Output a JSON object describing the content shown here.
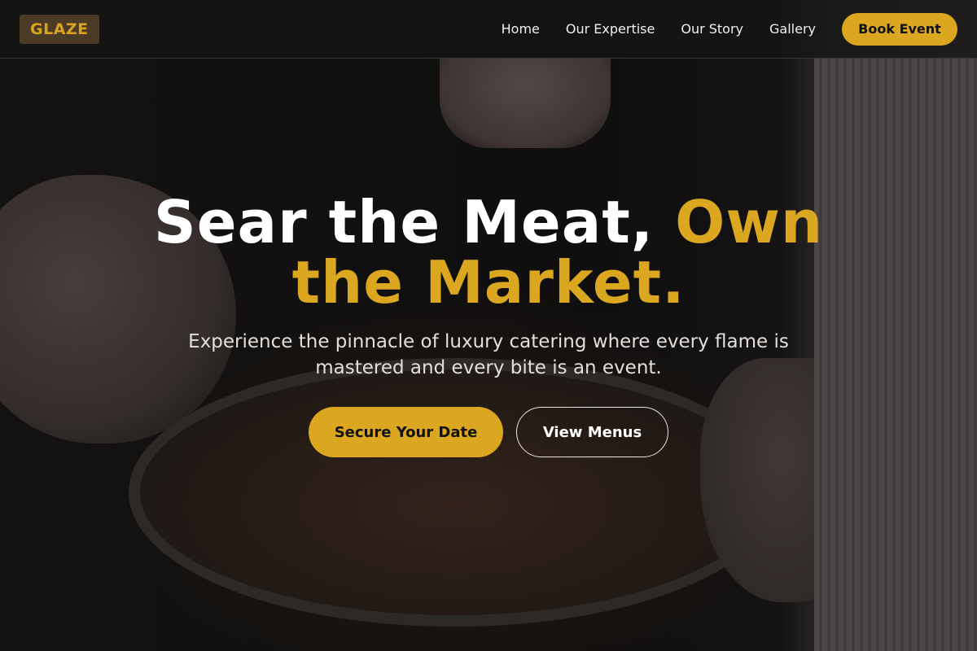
{
  "brand": {
    "logo_text": "GLAZE",
    "accent_color": "#dba721"
  },
  "nav": {
    "links": [
      {
        "label": "Home"
      },
      {
        "label": "Our Expertise"
      },
      {
        "label": "Our Story"
      },
      {
        "label": "Gallery"
      }
    ],
    "cta_label": "Book Event"
  },
  "hero": {
    "headline_white": "Sear the Meat, ",
    "headline_accent_1": "Own",
    "headline_accent_2": "the Market.",
    "subtext": "Experience the pinnacle of luxury catering where every flame is mastered and every bite is an event.",
    "primary_cta": "Secure Your Date",
    "secondary_cta": "View Menus",
    "background_image": "plated-food-photo"
  }
}
